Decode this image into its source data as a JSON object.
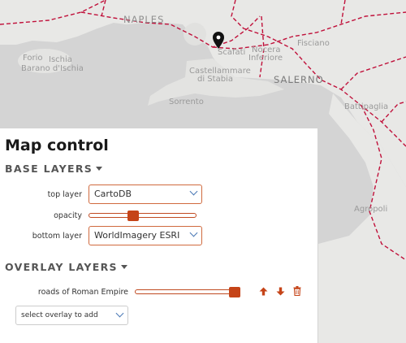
{
  "map": {
    "places": {
      "naples": "NAPLES",
      "salerno": "SALERNO",
      "fisciano": "Fisciano",
      "scafati": "Scafati",
      "nocera": "Nocera",
      "inferiore": "Inferiore",
      "castellammare": "Castellammare",
      "di_stabia": "di Stabia",
      "sorrento": "Sorrento",
      "ischia": "Ischia",
      "forio": "Forio",
      "barano": "Barano d'Ischia",
      "battipaglia": "Battipaglia",
      "agropoli": "Agropoli"
    },
    "marker_icon": "map-marker-icon"
  },
  "panel": {
    "title": "Map control",
    "base_layers": {
      "heading": "BASE LAYERS",
      "top_label": "top layer",
      "top_value": "CartoDB",
      "opacity_label": "opacity",
      "opacity_value": 0.4,
      "bottom_label": "bottom layer",
      "bottom_value": "WorldImagery ESRI"
    },
    "overlay_layers": {
      "heading": "OVERLAY LAYERS",
      "items": [
        {
          "label": "roads of Roman Empire",
          "opacity": 1.0
        }
      ],
      "add_placeholder": "select overlay to add"
    }
  },
  "colors": {
    "accent": "#c54418",
    "road": "#c0103a",
    "land": "#e9e9e7",
    "sea": "#d2d2d2"
  }
}
